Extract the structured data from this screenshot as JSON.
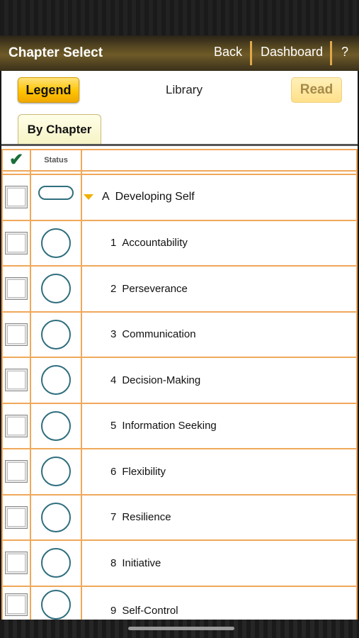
{
  "navbar": {
    "title": "Chapter Select",
    "back_label": "Back",
    "dashboard_label": "Dashboard",
    "help_label": "?"
  },
  "toolbar": {
    "legend_label": "Legend",
    "library_label": "Library",
    "read_label": "Read"
  },
  "tabs": [
    {
      "label": "By Chapter",
      "selected": true
    }
  ],
  "table": {
    "header": {
      "check_icon": "checkmark-icon",
      "status_label": "Status"
    },
    "rows": [
      {
        "prefix": "A",
        "title": "Developing Self",
        "type": "section",
        "status": "pill",
        "expanded": true
      },
      {
        "prefix": "1",
        "title": "Accountability",
        "type": "chapter",
        "status": "circle"
      },
      {
        "prefix": "2",
        "title": "Perseverance",
        "type": "chapter",
        "status": "circle"
      },
      {
        "prefix": "3",
        "title": "Communication",
        "type": "chapter",
        "status": "circle"
      },
      {
        "prefix": "4",
        "title": "Decision-Making",
        "type": "chapter",
        "status": "circle"
      },
      {
        "prefix": "5",
        "title": "Information Seeking",
        "type": "chapter",
        "status": "circle"
      },
      {
        "prefix": "6",
        "title": "Flexibility",
        "type": "chapter",
        "status": "circle"
      },
      {
        "prefix": "7",
        "title": "Resilience",
        "type": "chapter",
        "status": "circle"
      },
      {
        "prefix": "8",
        "title": "Initiative",
        "type": "chapter",
        "status": "circle"
      },
      {
        "prefix": "9",
        "title": "Self-Control",
        "type": "chapter",
        "status": "circle"
      }
    ]
  },
  "colors": {
    "accent_gold": "#ffc400",
    "table_border": "#f0a85a",
    "status_ring": "#2f6e7e",
    "check_green": "#1a6e3a"
  }
}
